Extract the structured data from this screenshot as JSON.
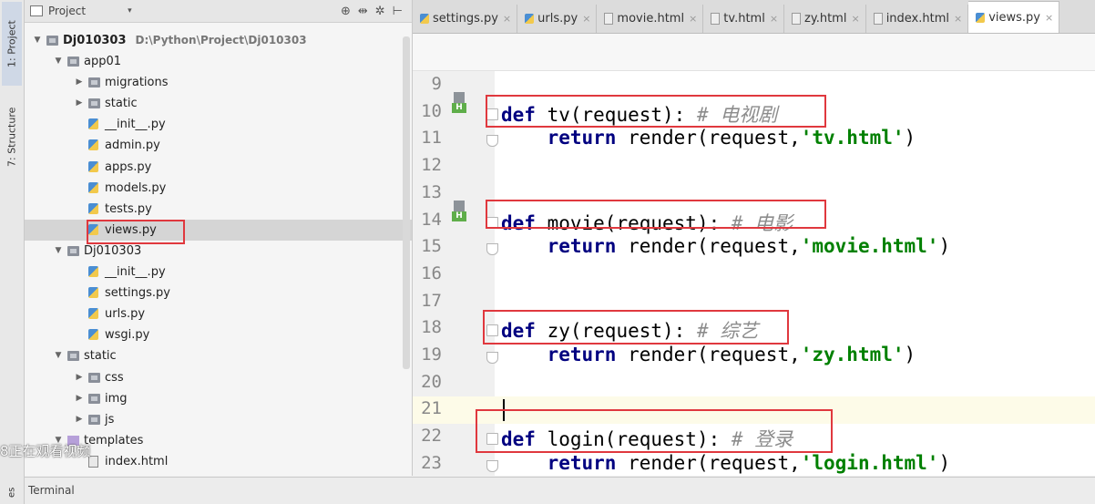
{
  "toolstrip": {
    "project_tab": "1: Project",
    "structure_tab": "7: Structure",
    "bottom_tab": "es"
  },
  "project_pane": {
    "title": "Project",
    "caret": "▾",
    "tools": [
      "⊕",
      "⇹",
      "✲",
      "⊢"
    ]
  },
  "tree": [
    {
      "depth": 0,
      "arrow": "▼",
      "icon": "folder",
      "label": "Dj010303",
      "bold": true,
      "path": "D:\\Python\\Project\\Dj010303"
    },
    {
      "depth": 1,
      "arrow": "▼",
      "icon": "folder",
      "label": "app01"
    },
    {
      "depth": 2,
      "arrow": "▶",
      "icon": "folder",
      "label": "migrations"
    },
    {
      "depth": 2,
      "arrow": "▶",
      "icon": "folder",
      "label": "static"
    },
    {
      "depth": 2,
      "arrow": "",
      "icon": "py",
      "label": "__init__.py"
    },
    {
      "depth": 2,
      "arrow": "",
      "icon": "py",
      "label": "admin.py"
    },
    {
      "depth": 2,
      "arrow": "",
      "icon": "py",
      "label": "apps.py"
    },
    {
      "depth": 2,
      "arrow": "",
      "icon": "py",
      "label": "models.py"
    },
    {
      "depth": 2,
      "arrow": "",
      "icon": "py",
      "label": "tests.py"
    },
    {
      "depth": 2,
      "arrow": "",
      "icon": "py",
      "label": "views.py",
      "selected": true
    },
    {
      "depth": 1,
      "arrow": "▼",
      "icon": "folder",
      "label": "Dj010303"
    },
    {
      "depth": 2,
      "arrow": "",
      "icon": "py",
      "label": "__init__.py"
    },
    {
      "depth": 2,
      "arrow": "",
      "icon": "py",
      "label": "settings.py"
    },
    {
      "depth": 2,
      "arrow": "",
      "icon": "py",
      "label": "urls.py"
    },
    {
      "depth": 2,
      "arrow": "",
      "icon": "py",
      "label": "wsgi.py"
    },
    {
      "depth": 1,
      "arrow": "▼",
      "icon": "folder",
      "label": "static"
    },
    {
      "depth": 2,
      "arrow": "▶",
      "icon": "folder",
      "label": "css"
    },
    {
      "depth": 2,
      "arrow": "▶",
      "icon": "folder",
      "label": "img"
    },
    {
      "depth": 2,
      "arrow": "▶",
      "icon": "folder",
      "label": "js"
    },
    {
      "depth": 1,
      "arrow": "▼",
      "icon": "folder-purple",
      "label": "templates"
    },
    {
      "depth": 2,
      "arrow": "",
      "icon": "html",
      "label": "index.html"
    }
  ],
  "watermark": "8正在观看视频",
  "tabs": [
    {
      "label": "settings.py",
      "icon": "py"
    },
    {
      "label": "urls.py",
      "icon": "py"
    },
    {
      "label": "movie.html",
      "icon": "html"
    },
    {
      "label": "tv.html",
      "icon": "html"
    },
    {
      "label": "zy.html",
      "icon": "html"
    },
    {
      "label": "index.html",
      "icon": "html"
    },
    {
      "label": "views.py",
      "icon": "py",
      "active": true
    }
  ],
  "tab_close": "×",
  "code_lines": [
    {
      "num": "9",
      "tokens": []
    },
    {
      "num": "10",
      "icon": true,
      "fold": "start",
      "tokens": [
        {
          "t": "kw",
          "v": "def"
        },
        {
          "t": "p",
          "v": " tv(request): "
        },
        {
          "t": "cmt",
          "v": "# 电视剧"
        }
      ]
    },
    {
      "num": "11",
      "fold": "end",
      "tokens": [
        {
          "t": "p",
          "v": "    "
        },
        {
          "t": "kw",
          "v": "return"
        },
        {
          "t": "p",
          "v": " render(request,"
        },
        {
          "t": "str",
          "v": "'tv.html'"
        },
        {
          "t": "p",
          "v": ")"
        }
      ]
    },
    {
      "num": "12",
      "tokens": []
    },
    {
      "num": "13",
      "tokens": []
    },
    {
      "num": "14",
      "icon": true,
      "fold": "start",
      "tokens": [
        {
          "t": "kw",
          "v": "def"
        },
        {
          "t": "p",
          "v": " movie(request): "
        },
        {
          "t": "cmt",
          "v": "# 电影"
        }
      ]
    },
    {
      "num": "15",
      "fold": "end",
      "tokens": [
        {
          "t": "p",
          "v": "    "
        },
        {
          "t": "kw",
          "v": "return"
        },
        {
          "t": "p",
          "v": " render(request,"
        },
        {
          "t": "str",
          "v": "'movie.html'"
        },
        {
          "t": "p",
          "v": ")"
        }
      ]
    },
    {
      "num": "16",
      "tokens": []
    },
    {
      "num": "17",
      "tokens": []
    },
    {
      "num": "18",
      "fold": "start",
      "tokens": [
        {
          "t": "kw",
          "v": "def"
        },
        {
          "t": "p",
          "v": " zy(request): "
        },
        {
          "t": "cmt",
          "v": "# 综艺"
        }
      ]
    },
    {
      "num": "19",
      "fold": "end",
      "tokens": [
        {
          "t": "p",
          "v": "    "
        },
        {
          "t": "kw",
          "v": "return"
        },
        {
          "t": "p",
          "v": " render(request,"
        },
        {
          "t": "str",
          "v": "'zy.html'"
        },
        {
          "t": "p",
          "v": ")"
        }
      ]
    },
    {
      "num": "20",
      "tokens": []
    },
    {
      "num": "21",
      "current": true,
      "caret": true,
      "tokens": []
    },
    {
      "num": "22",
      "fold": "start",
      "tokens": [
        {
          "t": "kw",
          "v": "def"
        },
        {
          "t": "p",
          "v": " login(request): "
        },
        {
          "t": "cmt",
          "v": "# 登录"
        }
      ]
    },
    {
      "num": "23",
      "fold": "end",
      "tokens": [
        {
          "t": "p",
          "v": "    "
        },
        {
          "t": "kw",
          "v": "return"
        },
        {
          "t": "p",
          "v": " render(request,"
        },
        {
          "t": "str",
          "v": "'login.html'"
        },
        {
          "t": "p",
          "v": ")"
        }
      ]
    }
  ],
  "gutter_badge": "H",
  "terminal": "Terminal",
  "colors": {
    "highlight_box": "#e0383e",
    "keyword": "#000080",
    "string": "#008000",
    "comment": "#8c8c8c"
  }
}
